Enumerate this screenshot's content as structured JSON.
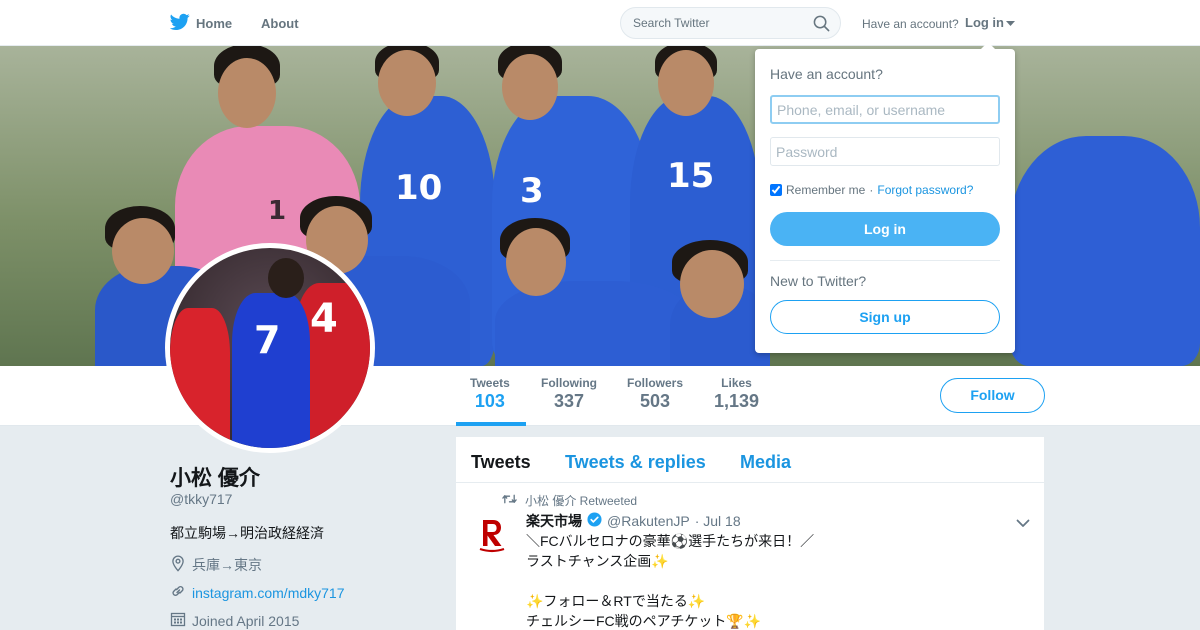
{
  "nav": {
    "home_label": "Home",
    "about_label": "About",
    "search_placeholder": "Search Twitter",
    "have_account": "Have an account?",
    "login_label": "Log in"
  },
  "profile": {
    "name": "小松 優介",
    "handle": "@tkky717",
    "bio": "都立駒場→明治政経経済",
    "location": "兵庫→東京",
    "website": "instagram.com/mdky717",
    "joined": "Joined April 2015"
  },
  "stats": [
    {
      "label": "Tweets",
      "value": "103"
    },
    {
      "label": "Following",
      "value": "337"
    },
    {
      "label": "Followers",
      "value": "503"
    },
    {
      "label": "Likes",
      "value": "1,139"
    }
  ],
  "follow_label": "Follow",
  "timeline": {
    "tabs": [
      "Tweets",
      "Tweets & replies",
      "Media"
    ],
    "tweet": {
      "retweet_by": "小松 優介 Retweeted",
      "author_name": "楽天市場",
      "author_handle": "@RakutenJP",
      "date": "· Jul 18",
      "lines": [
        "＼FCバルセロナの豪華⚽選手たちが来日！／",
        "ラストチャンス企画✨",
        "",
        "✨フォロー＆RTで当たる✨",
        "チェルシーFC戦のペアチケット🏆✨"
      ]
    }
  },
  "login_dropdown": {
    "title": "Have an account?",
    "username_placeholder": "Phone, email, or username",
    "password_placeholder": "Password",
    "remember_label": "Remember me",
    "separator": "·",
    "forgot_label": "Forgot password?",
    "login_button": "Log in",
    "new_label": "New to Twitter?",
    "signup_button": "Sign up"
  },
  "banner_jersey_numbers": [
    "1",
    "10",
    "3",
    "15"
  ],
  "avatar_jersey_numbers": [
    "7",
    "4"
  ],
  "colors": {
    "brand_blue": "#1da1f2",
    "login_button": "#4ab3f4",
    "link": "#1b95e0",
    "text_secondary": "#657786",
    "verified": "#1da1f2",
    "rakuten_red": "#bf0000"
  }
}
